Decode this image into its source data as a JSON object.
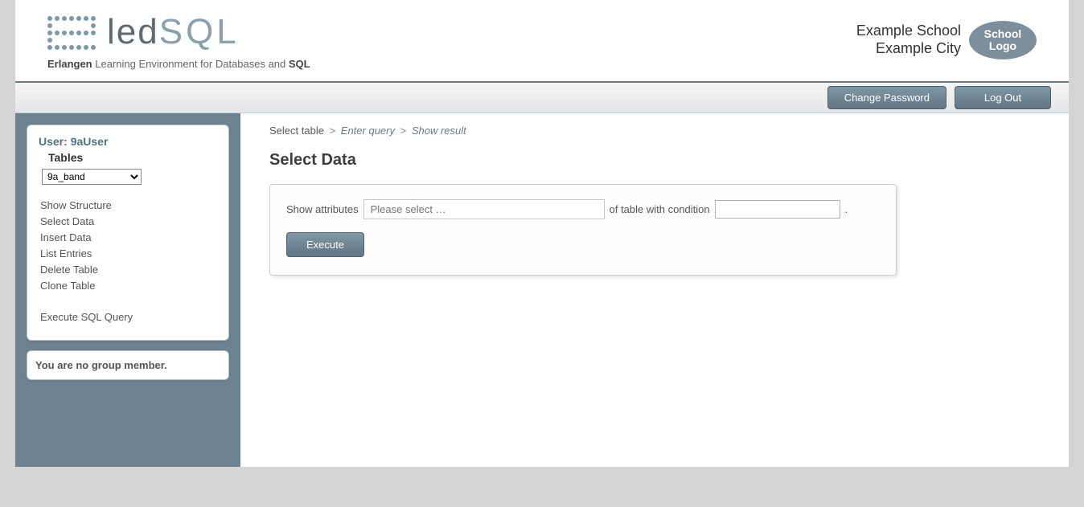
{
  "header": {
    "logo_text_led": "led",
    "logo_text_sql": "SQL",
    "sub_erlangen": "Erlangen",
    "sub_mid": " Learning Environment for Databases and ",
    "sub_sql": "SQL",
    "school_line1": "Example School",
    "school_line2": "Example City",
    "school_logo_text": "School Logo"
  },
  "toolbar": {
    "change_password": "Change Password",
    "logout": "Log Out"
  },
  "sidebar": {
    "user_prefix": "User: ",
    "user_name": "9aUser",
    "tables_label": "Tables",
    "selected_table": "9a_band",
    "links": {
      "show_structure": "Show Structure",
      "select_data": "Select Data",
      "insert_data": "Insert Data",
      "list_entries": "List Entries",
      "delete_table": "Delete Table",
      "clone_table": "Clone Table",
      "execute_sql": "Execute SQL Query"
    },
    "group_msg": "You are no group member."
  },
  "breadcrumb": {
    "step1": "Select table",
    "step2": "Enter query",
    "step3": "Show result",
    "sep": ">"
  },
  "main": {
    "title": "Select Data",
    "show_attributes_label": "Show attributes",
    "attr_placeholder": "Please select …",
    "of_table_label": "of table with condition",
    "period": ".",
    "execute": "Execute"
  }
}
